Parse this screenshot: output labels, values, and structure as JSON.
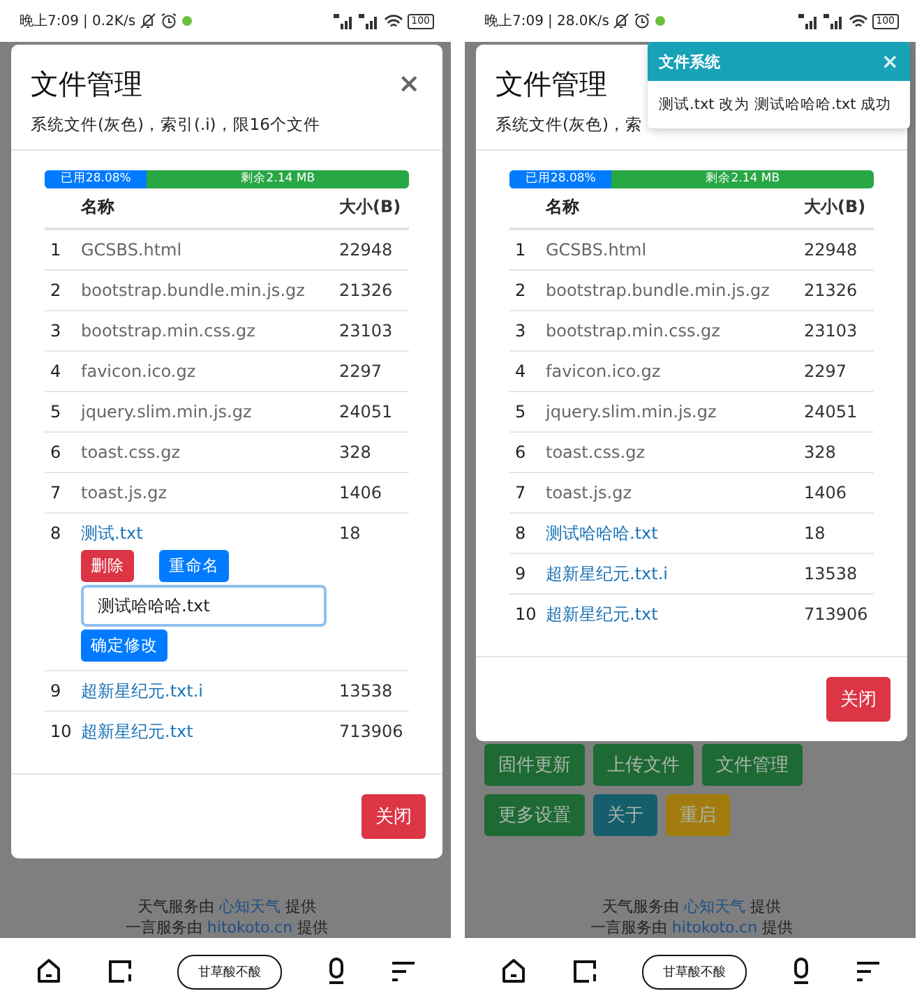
{
  "screens": [
    {
      "status_bar": {
        "time": "晚上7:09",
        "speed": "| 0.2K/s",
        "battery": "100"
      },
      "modal": {
        "title": "文件管理",
        "close": "×",
        "subtitle": "系统文件(灰色)，索引(.i)，限16个文件",
        "storage": {
          "used_label": "已用28.08%",
          "level": 0.2808,
          "free_label": "剩余2.14 MB"
        },
        "columns": [
          "名称",
          "大小(B)"
        ],
        "rows": [
          {
            "index": "1",
            "name": "GCSBS.html",
            "size": "22948",
            "kind": "system"
          },
          {
            "index": "2",
            "name": "bootstrap.bundle.min.js.gz",
            "size": "21326",
            "kind": "system"
          },
          {
            "index": "3",
            "name": "bootstrap.min.css.gz",
            "size": "23103",
            "kind": "system"
          },
          {
            "index": "4",
            "name": "favicon.ico.gz",
            "size": "2297",
            "kind": "system"
          },
          {
            "index": "5",
            "name": "jquery.slim.min.js.gz",
            "size": "24051",
            "kind": "system"
          },
          {
            "index": "6",
            "name": "toast.css.gz",
            "size": "328",
            "kind": "system"
          },
          {
            "index": "7",
            "name": "toast.js.gz",
            "size": "1406",
            "kind": "system"
          },
          {
            "index": "8",
            "name": "测试.txt",
            "size": "18",
            "kind": "user",
            "actions": {
              "delete": "删除",
              "rename": "重命名",
              "value": "测试哈哈哈.txt",
              "confirm": "确定修改"
            }
          },
          {
            "index": "9",
            "name": "超新星纪元.txt.i",
            "size": "13538",
            "kind": "user"
          },
          {
            "index": "10",
            "name": "超新星纪元.txt",
            "size": "713906",
            "kind": "user"
          }
        ],
        "close_button": "关闭"
      },
      "footer": [
        {
          "before": "天气服务由 ",
          "link": "心知天气",
          "after": " 提供"
        },
        {
          "before": "一言服务由 ",
          "link": "hitokoto.cn",
          "after": " 提供"
        }
      ],
      "nav": {
        "pill": "甘草酸不酸"
      }
    },
    {
      "status_bar": {
        "time": "晚上7:09",
        "speed": "| 28.0K/s",
        "battery": "100"
      },
      "toast": {
        "title": "文件系统",
        "close": "×",
        "message": "测试.txt 改为 测试哈哈哈.txt 成功"
      },
      "modal": {
        "title": "文件管理",
        "subtitle": "系统文件(灰色)，索",
        "storage": {
          "used_label": "已用28.08%",
          "level": 0.2808,
          "free_label": "剩余2.14 MB"
        },
        "columns": [
          "名称",
          "大小(B)"
        ],
        "rows": [
          {
            "index": "1",
            "name": "GCSBS.html",
            "size": "22948",
            "kind": "system"
          },
          {
            "index": "2",
            "name": "bootstrap.bundle.min.js.gz",
            "size": "21326",
            "kind": "system"
          },
          {
            "index": "3",
            "name": "bootstrap.min.css.gz",
            "size": "23103",
            "kind": "system"
          },
          {
            "index": "4",
            "name": "favicon.ico.gz",
            "size": "2297",
            "kind": "system"
          },
          {
            "index": "5",
            "name": "jquery.slim.min.js.gz",
            "size": "24051",
            "kind": "system"
          },
          {
            "index": "6",
            "name": "toast.css.gz",
            "size": "328",
            "kind": "system"
          },
          {
            "index": "7",
            "name": "toast.js.gz",
            "size": "1406",
            "kind": "system"
          },
          {
            "index": "8",
            "name": "测试哈哈哈.txt",
            "size": "18",
            "kind": "user"
          },
          {
            "index": "9",
            "name": "超新星纪元.txt.i",
            "size": "13538",
            "kind": "user"
          },
          {
            "index": "10",
            "name": "超新星纪元.txt",
            "size": "713906",
            "kind": "user"
          }
        ],
        "close_button": "关闭"
      },
      "background_buttons": [
        [
          {
            "label": "固件更新",
            "color": "#1e6a34"
          },
          {
            "label": "上传文件",
            "color": "#1e6a34"
          },
          {
            "label": "文件管理",
            "color": "#1e6a34"
          }
        ],
        [
          {
            "label": "更多设置",
            "color": "#1e6a34"
          },
          {
            "label": "关于",
            "color": "#155e6c"
          },
          {
            "label": "重启",
            "color": "#a37c10"
          }
        ]
      ],
      "footer": [
        {
          "before": "天气服务由 ",
          "link": "心知天气",
          "after": " 提供"
        },
        {
          "before": "一言服务由 ",
          "link": "hitokoto.cn",
          "after": " 提供"
        }
      ],
      "nav": {
        "pill": "甘草酸不酸"
      }
    }
  ]
}
